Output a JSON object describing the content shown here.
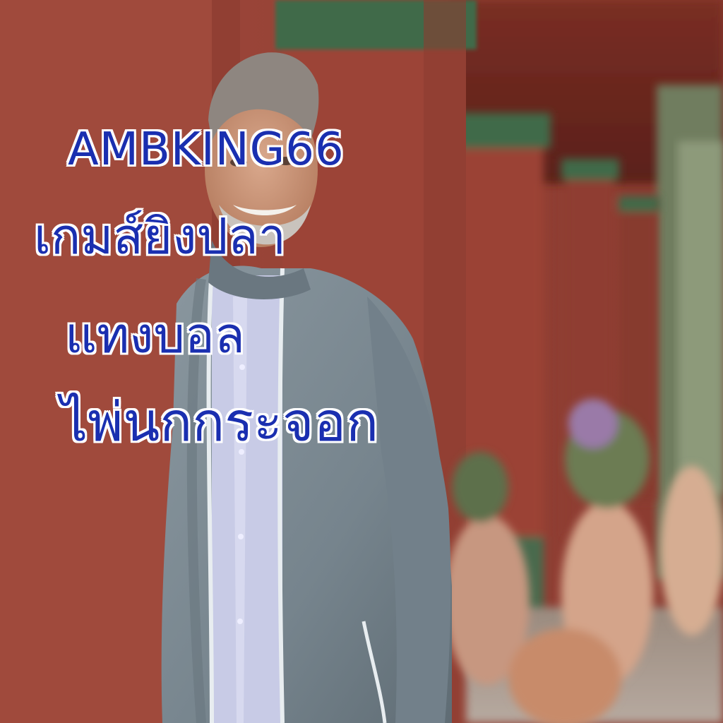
{
  "captions": {
    "brand": "AMBKING66",
    "line1": "เกมส์ยิงปลา",
    "line2": "แทงบอล",
    "line3": "ไพ่นกกระจอก"
  },
  "colors": {
    "caption_fill": "#1a2fb0",
    "caption_outline": "#ffffff",
    "wall_red": "#9c4437",
    "trim_green": "#3f6a4a",
    "jacket_gray": "#7f8d96",
    "shirt_blue": "#c8cbe6"
  }
}
